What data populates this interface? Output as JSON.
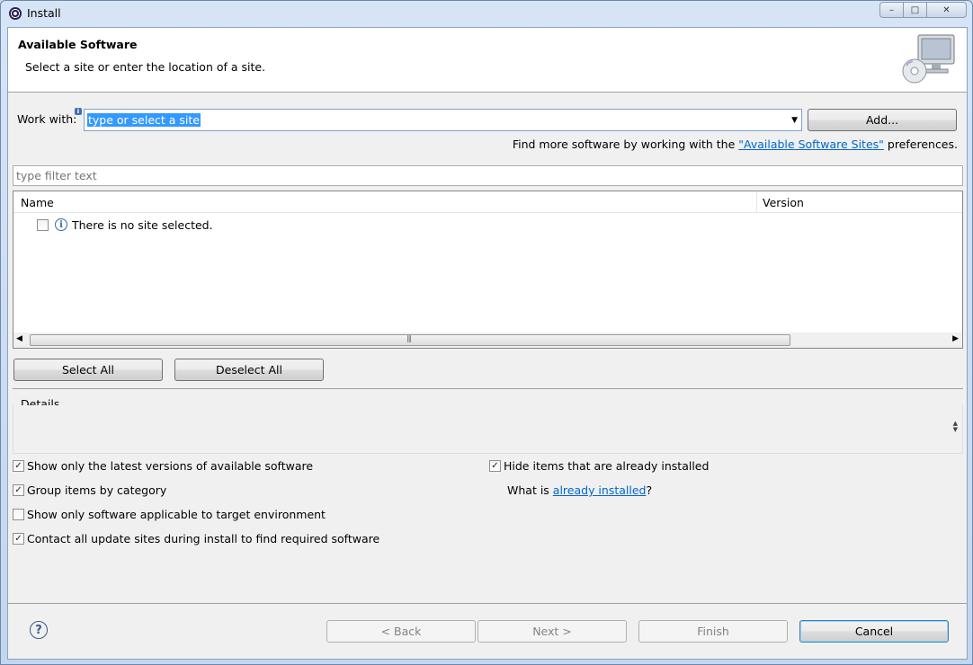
{
  "window": {
    "title": "Install",
    "controls": {
      "minimize": "–",
      "maximize": "□",
      "close": "✕"
    }
  },
  "banner": {
    "title": "Available Software",
    "subtitle": "Select a site or enter the location of a site."
  },
  "work_with": {
    "label": "Work with:",
    "value": "type or select a site",
    "add_button": "Add..."
  },
  "find_more": {
    "prefix": "Find more software by working with the ",
    "link": "\"Available Software Sites\"",
    "suffix": " preferences."
  },
  "filter": {
    "placeholder": "type filter text"
  },
  "tree": {
    "columns": [
      "Name",
      "Version"
    ],
    "rows": [
      {
        "label": "There is no site selected.",
        "checked": false
      }
    ]
  },
  "buttons": {
    "select_all": "Select All",
    "deselect_all": "Deselect All",
    "back": "< Back",
    "next": "Next >",
    "finish": "Finish",
    "cancel": "Cancel"
  },
  "details": {
    "label": "Details"
  },
  "options": {
    "latest_versions": {
      "label": "Show only the latest versions of available software",
      "checked": true
    },
    "group_by_category": {
      "label": "Group items by category",
      "checked": true
    },
    "target_env": {
      "label": "Show only software applicable to target environment",
      "checked": false
    },
    "contact_sites": {
      "label": "Contact all update sites during install to find required software",
      "checked": true
    },
    "hide_installed": {
      "label": "Hide items that are already installed",
      "checked": true
    }
  },
  "what_is": {
    "prefix": "What is ",
    "link": "already installed",
    "suffix": "?"
  },
  "colors": {
    "accent": "#3399ff",
    "link": "#0066cc"
  }
}
